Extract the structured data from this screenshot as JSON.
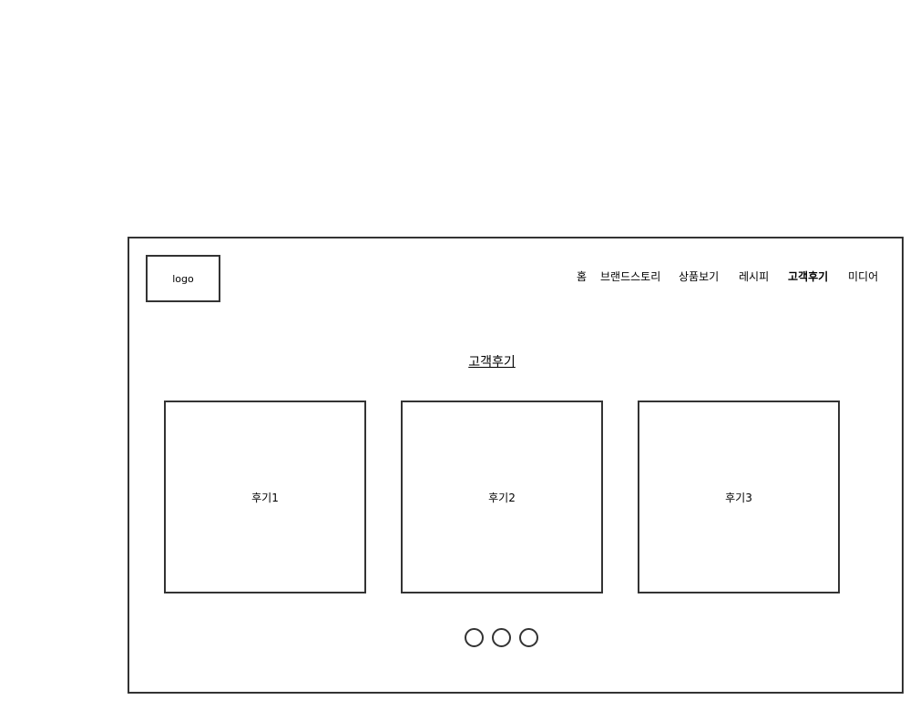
{
  "header": {
    "logo_label": "logo",
    "nav": [
      {
        "label": "홈",
        "active": false
      },
      {
        "label": "브랜드스토리",
        "active": false
      },
      {
        "label": "상품보기",
        "active": false
      },
      {
        "label": "레시피",
        "active": false
      },
      {
        "label": "고객후기",
        "active": true
      },
      {
        "label": "미디어",
        "active": false
      }
    ]
  },
  "main": {
    "section_title": "고객후기",
    "reviews": [
      {
        "label": "후기1"
      },
      {
        "label": "후기2"
      },
      {
        "label": "후기3"
      }
    ],
    "pagination": {
      "dot_count": 3
    }
  },
  "colors": {
    "border": "#333333",
    "background": "#ffffff",
    "text": "#000000"
  }
}
